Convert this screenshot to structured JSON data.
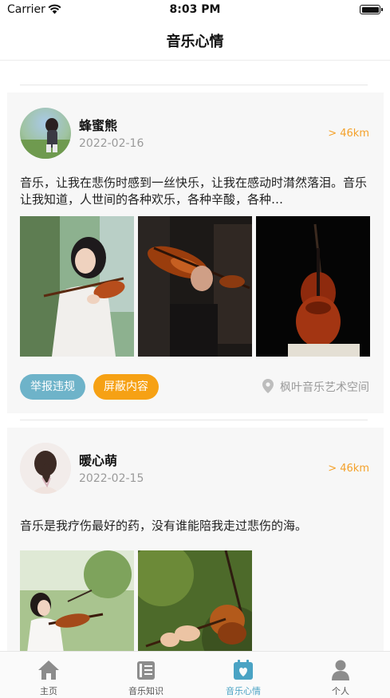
{
  "status_bar": {
    "carrier": "Carrier",
    "time": "8:03 PM"
  },
  "nav": {
    "title": "音乐心情"
  },
  "posts": [
    {
      "username": "蜂蜜熊",
      "date": "2022-02-16",
      "distance": "> 46km",
      "content": "音乐，让我在悲伤时感到一丝快乐，让我在感动时潸然落泪。音乐让我知道，人世间的各种欢乐，各种辛酸，各种…",
      "actions": {
        "report": "举报违规",
        "block": "屏蔽内容"
      },
      "location": "枫叶音乐艺术空间"
    },
    {
      "username": "暖心萌",
      "date": "2022-02-15",
      "distance": "> 46km",
      "content": "音乐是我疗伤最好的药，没有谁能陪我走过悲伤的海。"
    }
  ],
  "tabs": [
    {
      "label": "主页",
      "icon": "home-icon"
    },
    {
      "label": "音乐知识",
      "icon": "book-icon"
    },
    {
      "label": "音乐心情",
      "icon": "calendar-heart-icon",
      "active": true
    },
    {
      "label": "个人",
      "icon": "person-icon"
    }
  ],
  "colors": {
    "accent": "#4aa3c4",
    "distance": "#f4a12a",
    "report": "#6eb3c9",
    "block": "#f6a114"
  }
}
